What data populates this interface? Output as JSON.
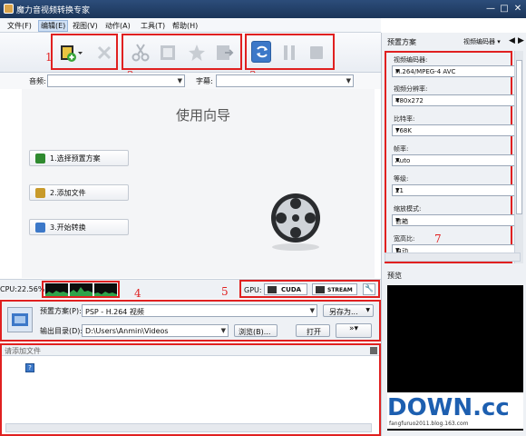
{
  "window": {
    "title": "魔力音视频转换专家",
    "minimize": "—",
    "maximize": "□",
    "close": "✕"
  },
  "menu": [
    "文件(F)",
    "编辑(E)",
    "视图(V)",
    "动作(A)",
    "工具(T)",
    "帮助(H)"
  ],
  "annotations": [
    "1",
    "2",
    "3",
    "4",
    "5",
    "7"
  ],
  "toolbar": {
    "add_icon": "film-add-icon",
    "remove_icon": "delete-icon",
    "cut_icon": "scissors-icon",
    "film_icon": "film-icon",
    "star_icon": "effects-icon",
    "export_icon": "merge-icon",
    "convert_icon": "convert-icon",
    "pause_icon": "pause-icon",
    "stop_icon": "stop-icon"
  },
  "fields": {
    "audio_label": "音频:",
    "subtitle_label": "字幕:"
  },
  "guide": {
    "title": "使用向导",
    "step1": "1.选择预置方案",
    "step2": "2.添加文件",
    "step3": "3.开始转换"
  },
  "status": {
    "cpu": "CPU:22.56%",
    "gpu_label": "GPU:",
    "cuda": "CUDA",
    "stream": "STREAM"
  },
  "preset": {
    "preset_label": "预置方案(P):",
    "preset_value": "PSP - H.264 视频",
    "save_as": "另存为...",
    "output_label": "输出目录(D):",
    "output_value": "D:\\Users\\Anmin\\Videos",
    "browse": "浏览(B)...",
    "open": "打开"
  },
  "list": {
    "header": "请添加文件"
  },
  "right": {
    "title": "预置方案",
    "encoder_tab": "视频编码器 ▾",
    "fields": [
      {
        "label": "视频编码器:",
        "value": "H.264/MPEG-4 AVC"
      },
      {
        "label": "视频分辨率:",
        "value": "480x272"
      },
      {
        "label": "比特率:",
        "value": "768K"
      },
      {
        "label": "帧率:",
        "value": "Auto"
      },
      {
        "label": "等级:",
        "value": "21"
      },
      {
        "label": "缩放模式:",
        "value": "信箱"
      },
      {
        "label": "宽高比:",
        "value": "自动"
      }
    ],
    "preview_label": "预览",
    "watermark": "DOWN.cc",
    "watermark_small": "fangfuruo2011.blog.163.com"
  }
}
